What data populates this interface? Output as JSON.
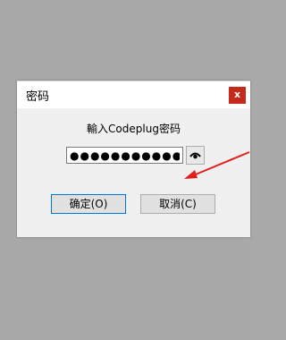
{
  "dialog": {
    "title": "密码",
    "close_label": "x",
    "prompt": "輸入Codeplug密码",
    "password_value": "●●●●●●●●●●●●",
    "ok_label": "确定(O)",
    "cancel_label": "取消(C)"
  },
  "icons": {
    "close": "close-icon",
    "show_password": "eye-icon",
    "annotation": "red-arrow-annotation"
  },
  "colors": {
    "background": "#a8a8a8",
    "close_button": "#c42b1c",
    "arrow": "#e0201c"
  }
}
